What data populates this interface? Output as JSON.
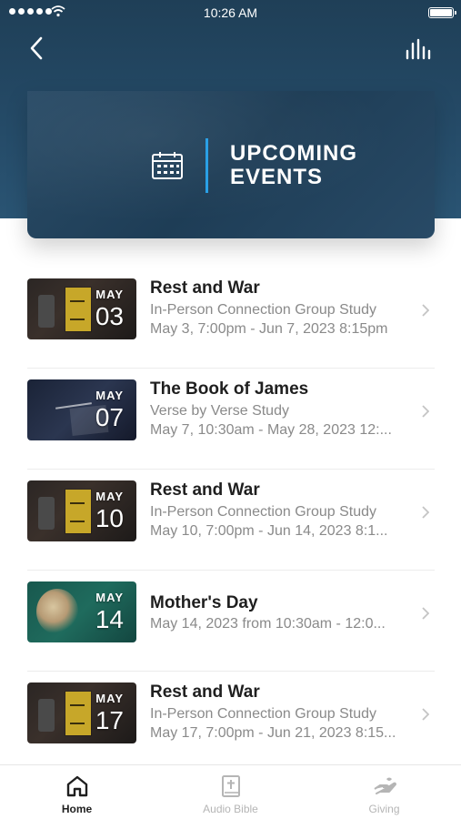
{
  "status_bar": {
    "time": "10:26 AM",
    "icons": [
      "signal-dots-icon",
      "wifi-icon",
      "battery-icon"
    ]
  },
  "nav": {
    "back_icon": "chevron-left-icon",
    "audio_icon": "audio-levels-icon"
  },
  "banner": {
    "icon": "calendar-icon",
    "title_line1": "UPCOMING",
    "title_line2": "EVENTS",
    "accent_color": "#2aa0e6"
  },
  "events": [
    {
      "month": "MAY",
      "day": "03",
      "title": "Rest and War",
      "subtitle": "In-Person Connection Group Study",
      "date": "May 3, 7:00pm - Jun 7, 2023 8:15pm"
    },
    {
      "month": "MAY",
      "day": "07",
      "title": "The Book of James",
      "subtitle": "Verse by Verse Study",
      "date": "May 7, 10:30am - May 28, 2023 12:..."
    },
    {
      "month": "MAY",
      "day": "10",
      "title": "Rest and War",
      "subtitle": "In-Person Connection Group Study",
      "date": "May 10, 7:00pm - Jun 14, 2023 8:1..."
    },
    {
      "month": "MAY",
      "day": "14",
      "title": "Mother's Day",
      "subtitle": "",
      "date": "May 14, 2023 from 10:30am - 12:0..."
    },
    {
      "month": "MAY",
      "day": "17",
      "title": "Rest and War",
      "subtitle": "In-Person Connection Group Study",
      "date": "May 17, 7:00pm - Jun 21, 2023 8:15..."
    }
  ],
  "tab_bar": {
    "tabs": [
      {
        "label": "Home",
        "icon": "home-icon",
        "active": true
      },
      {
        "label": "Audio Bible",
        "icon": "bible-icon",
        "active": false
      },
      {
        "label": "Giving",
        "icon": "giving-hand-icon",
        "active": false
      }
    ]
  },
  "colors": {
    "header_bg": "#254b68",
    "active_tab": "#1f1f1f",
    "inactive_tab": "#b5b5b5"
  }
}
